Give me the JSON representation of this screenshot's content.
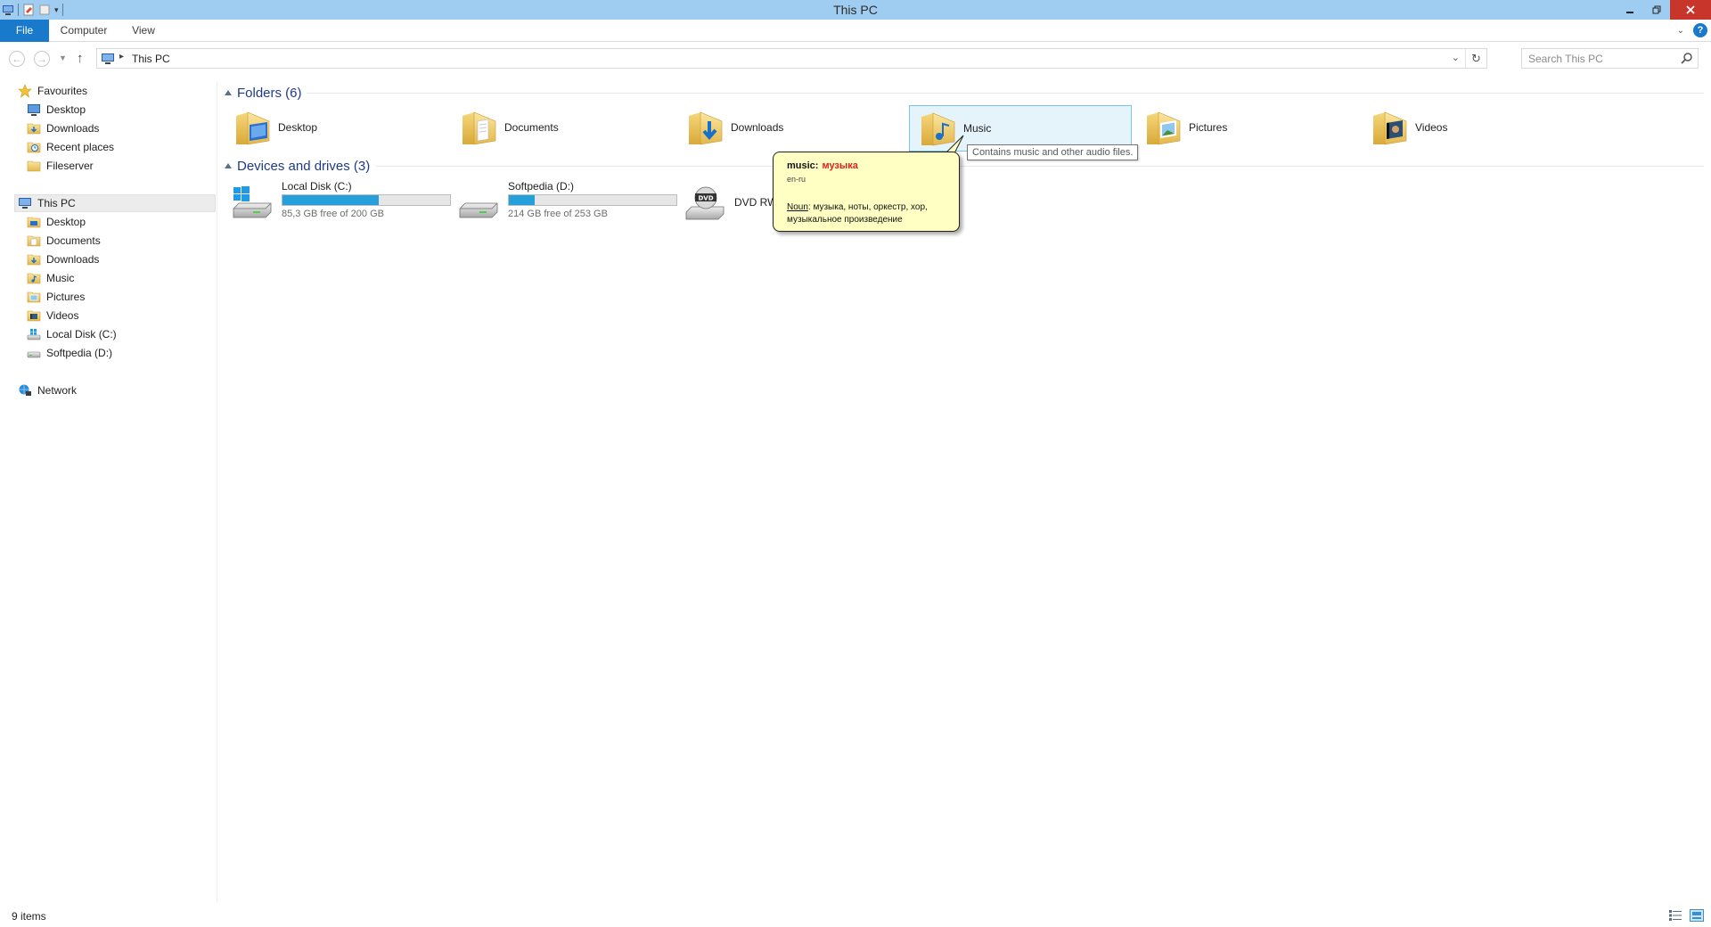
{
  "window": {
    "title": "This PC"
  },
  "ribbon": {
    "tabs": [
      "File",
      "Computer",
      "View"
    ]
  },
  "address": {
    "path": "This PC",
    "search_placeholder": "Search This PC"
  },
  "nav": {
    "favourites_label": "Favourites",
    "favourites": [
      {
        "label": "Desktop",
        "icon": "desktop-icon"
      },
      {
        "label": "Downloads",
        "icon": "downloads-folder-icon"
      },
      {
        "label": "Recent places",
        "icon": "recent-places-icon"
      },
      {
        "label": "Fileserver",
        "icon": "folder-icon"
      }
    ],
    "thispc_label": "This PC",
    "thispc": [
      {
        "label": "Desktop",
        "icon": "desktop-folder-icon"
      },
      {
        "label": "Documents",
        "icon": "documents-folder-icon"
      },
      {
        "label": "Downloads",
        "icon": "downloads-folder-icon"
      },
      {
        "label": "Music",
        "icon": "music-folder-icon"
      },
      {
        "label": "Pictures",
        "icon": "pictures-folder-icon"
      },
      {
        "label": "Videos",
        "icon": "videos-folder-icon"
      },
      {
        "label": "Local Disk (C:)",
        "icon": "local-disk-icon"
      },
      {
        "label": "Softpedia (D:)",
        "icon": "drive-icon"
      }
    ],
    "network_label": "Network"
  },
  "folders": {
    "title": "Folders (6)",
    "items": [
      {
        "label": "Desktop",
        "icon": "desktop-folder-icon"
      },
      {
        "label": "Documents",
        "icon": "documents-folder-icon"
      },
      {
        "label": "Downloads",
        "icon": "downloads-folder-icon"
      },
      {
        "label": "Music",
        "icon": "music-folder-icon"
      },
      {
        "label": "Pictures",
        "icon": "pictures-folder-icon"
      },
      {
        "label": "Videos",
        "icon": "videos-folder-icon"
      }
    ]
  },
  "devices": {
    "title": "Devices and drives (3)",
    "items": [
      {
        "name": "Local Disk (C:)",
        "free": "85,3 GB free of 200 GB",
        "used_fraction": 0.574
      },
      {
        "name": "Softpedia (D:)",
        "free": "214 GB free of 253 GB",
        "used_fraction": 0.154
      },
      {
        "name": "DVD RW"
      }
    ]
  },
  "tooltip": {
    "text": "Contains music and other audio files."
  },
  "balloon": {
    "word": "music:",
    "translation": "музыка",
    "lang": "en-ru",
    "pos": "Noun",
    "definition": ": музыка, ноты, оркестр, хор, музыкальное произведение"
  },
  "status": {
    "items_text": "9 items"
  },
  "colors": {
    "titlebar": "#9fcdf2",
    "file_tab": "#1979ca",
    "selection": "#e5f3fb",
    "drive_bar": "#26a0da",
    "close": "#c7352b",
    "balloon": "#ffffc4"
  }
}
